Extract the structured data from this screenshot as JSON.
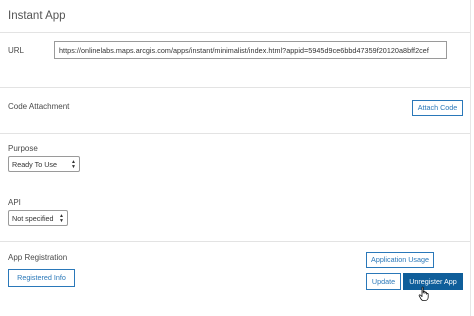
{
  "panel": {
    "title": "Instant App"
  },
  "url": {
    "label": "URL",
    "value": "https://onlinelabs.maps.arcgis.com/apps/instant/minimalist/index.html?appid=5945d9ce6bbd47359f20120a8bff2cef"
  },
  "code_attachment": {
    "label": "Code Attachment",
    "button": "Attach Code"
  },
  "purpose": {
    "label": "Purpose",
    "selected": "Ready To Use"
  },
  "api": {
    "label": "API",
    "selected": "Not specified"
  },
  "app_registration": {
    "label": "App Registration",
    "registered_info_button": "Registered Info",
    "application_usage_button": "Application Usage",
    "update_button": "Update",
    "unregister_button": "Unregister App"
  },
  "colors": {
    "accent": "#2a78b9",
    "primary_button": "#0f5e9a"
  }
}
